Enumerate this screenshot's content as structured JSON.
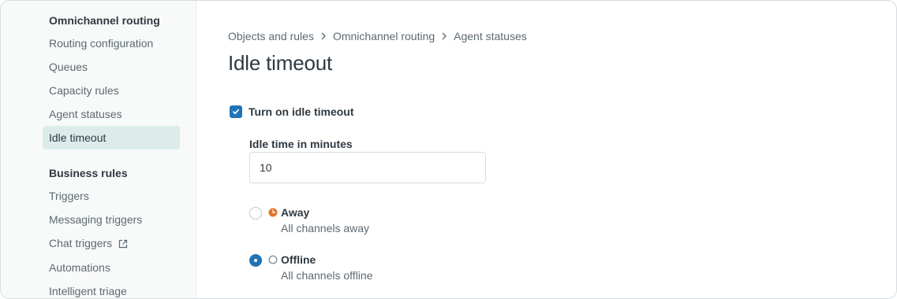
{
  "sidebar": {
    "groups": [
      {
        "title": "Omnichannel routing",
        "items": [
          {
            "label": "Routing configuration"
          },
          {
            "label": "Queues"
          },
          {
            "label": "Capacity rules"
          },
          {
            "label": "Agent statuses"
          },
          {
            "label": "Idle timeout",
            "active": true
          }
        ]
      },
      {
        "title": "Business rules",
        "items": [
          {
            "label": "Triggers"
          },
          {
            "label": "Messaging triggers"
          },
          {
            "label": "Chat triggers",
            "external": true
          },
          {
            "label": "Automations"
          },
          {
            "label": "Intelligent triage"
          }
        ]
      }
    ]
  },
  "breadcrumb": [
    "Objects and rules",
    "Omnichannel routing",
    "Agent statuses"
  ],
  "page_title": "Idle timeout",
  "idle_toggle": {
    "label": "Turn on idle timeout",
    "checked": true
  },
  "idle_time": {
    "label": "Idle time in minutes",
    "value": "10"
  },
  "status_options": [
    {
      "title": "Away",
      "description": "All channels away",
      "checked": false,
      "icon": "clock-icon",
      "color": "#e0762b"
    },
    {
      "title": "Offline",
      "description": "All channels offline",
      "checked": true,
      "icon": "circle-outline-icon",
      "color": "#87929d"
    }
  ],
  "colors": {
    "accent": "#1f73b7",
    "active_nav_bg": "#dbeceb"
  }
}
